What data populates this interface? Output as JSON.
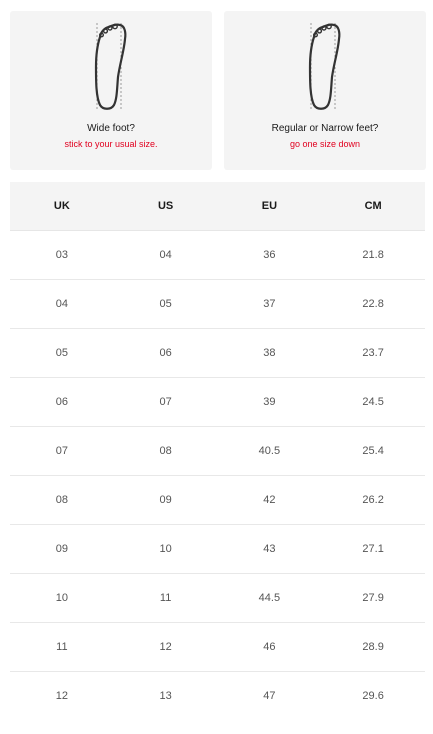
{
  "fit_tips": [
    {
      "icon": "foot-outline-icon",
      "title": "Wide foot?",
      "note": "stick to your usual size."
    },
    {
      "icon": "foot-outline-icon",
      "title": "Regular or Narrow feet?",
      "note": "go one size down"
    }
  ],
  "colors": {
    "card_bg": "#f4f4f4",
    "note_red": "#e1001f",
    "foot_stroke": "#333333",
    "measure_line": "#9a9a9a"
  },
  "size_table": {
    "headers": [
      "UK",
      "US",
      "EU",
      "CM"
    ],
    "rows": [
      [
        "03",
        "04",
        "36",
        "21.8"
      ],
      [
        "04",
        "05",
        "37",
        "22.8"
      ],
      [
        "05",
        "06",
        "38",
        "23.7"
      ],
      [
        "06",
        "07",
        "39",
        "24.5"
      ],
      [
        "07",
        "08",
        "40.5",
        "25.4"
      ],
      [
        "08",
        "09",
        "42",
        "26.2"
      ],
      [
        "09",
        "10",
        "43",
        "27.1"
      ],
      [
        "10",
        "11",
        "44.5",
        "27.9"
      ],
      [
        "11",
        "12",
        "46",
        "28.9"
      ],
      [
        "12",
        "13",
        "47",
        "29.6"
      ]
    ]
  }
}
